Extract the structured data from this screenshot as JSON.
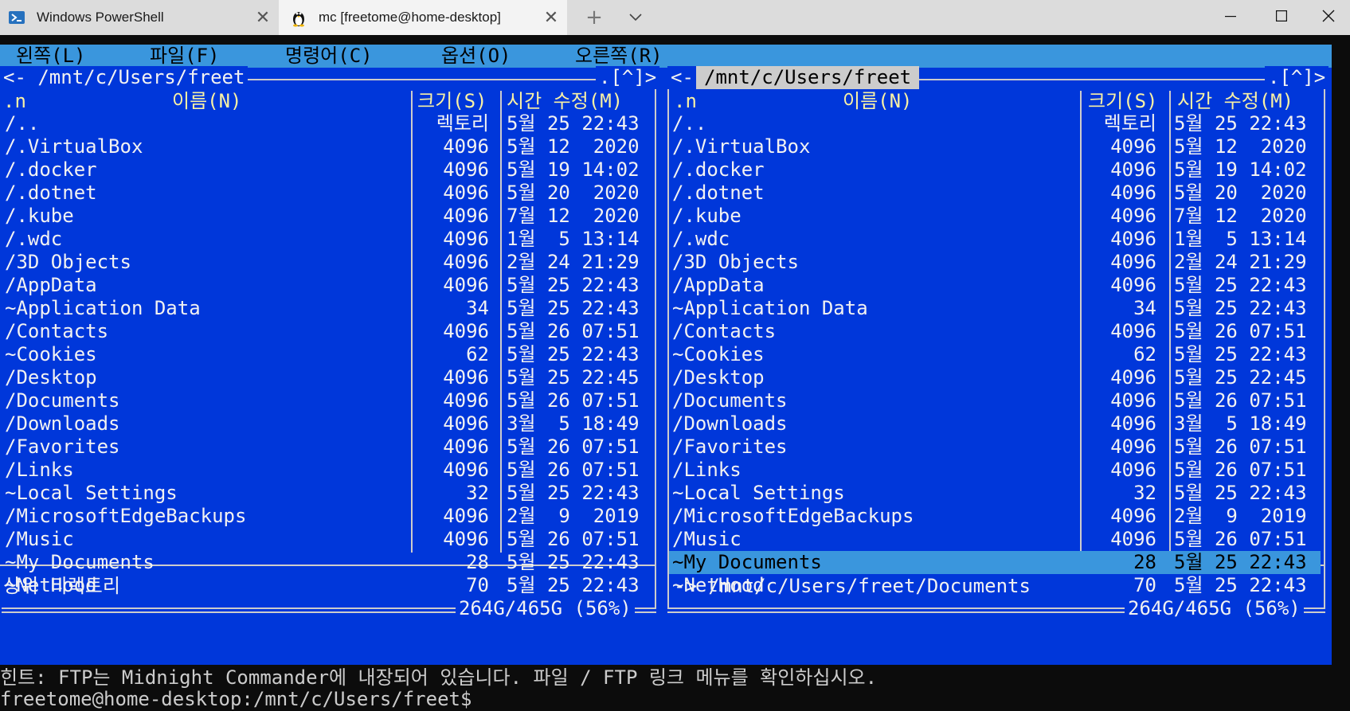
{
  "tabs": [
    {
      "title": "Windows PowerShell",
      "icon": "powershell-icon"
    },
    {
      "title": "mc [freetome@home-desktop]",
      "icon": "linux-penguin-icon"
    }
  ],
  "menu": [
    "왼쪽(L)",
    "파일(F)",
    "명령어(C)",
    "옵션(O)",
    "오른쪽(R)"
  ],
  "left_panel": {
    "path": "<- /mnt/c/Users/freet",
    "corner": ".[^]>",
    "sort_flag": ".n",
    "col_name": "이름(N)",
    "col_size": "크기(S)",
    "col_time": "시간 수정(M)",
    "status": "상위 디렉토리",
    "disk": "264G/465G (56%)"
  },
  "right_panel": {
    "path_prefix": "<-",
    "path": "/mnt/c/Users/freet",
    "corner": ".[^]>",
    "sort_flag": ".n",
    "col_name": "이름(N)",
    "col_size": "크기(S)",
    "col_time": "시간 수정(M)",
    "status": "-> /mnt/c/Users/freet/Documents",
    "disk": "264G/465G (56%)",
    "selected_index": 19
  },
  "files": [
    {
      "name": "/..",
      "size": "렉토리",
      "time": "5월 25 22:43"
    },
    {
      "name": "/.VirtualBox",
      "size": "4096",
      "time": "5월 12  2020"
    },
    {
      "name": "/.docker",
      "size": "4096",
      "time": "5월 19 14:02"
    },
    {
      "name": "/.dotnet",
      "size": "4096",
      "time": "5월 20  2020"
    },
    {
      "name": "/.kube",
      "size": "4096",
      "time": "7월 12  2020"
    },
    {
      "name": "/.wdc",
      "size": "4096",
      "time": "1월  5 13:14"
    },
    {
      "name": "/3D Objects",
      "size": "4096",
      "time": "2월 24 21:29"
    },
    {
      "name": "/AppData",
      "size": "4096",
      "time": "5월 25 22:43"
    },
    {
      "name": "~Application Data",
      "size": "34",
      "time": "5월 25 22:43"
    },
    {
      "name": "/Contacts",
      "size": "4096",
      "time": "5월 26 07:51"
    },
    {
      "name": "~Cookies",
      "size": "62",
      "time": "5월 25 22:43"
    },
    {
      "name": "/Desktop",
      "size": "4096",
      "time": "5월 25 22:45"
    },
    {
      "name": "/Documents",
      "size": "4096",
      "time": "5월 26 07:51"
    },
    {
      "name": "/Downloads",
      "size": "4096",
      "time": "3월  5 18:49"
    },
    {
      "name": "/Favorites",
      "size": "4096",
      "time": "5월 26 07:51"
    },
    {
      "name": "/Links",
      "size": "4096",
      "time": "5월 26 07:51"
    },
    {
      "name": "~Local Settings",
      "size": "32",
      "time": "5월 25 22:43"
    },
    {
      "name": "/MicrosoftEdgeBackups",
      "size": "4096",
      "time": "2월  9  2019"
    },
    {
      "name": "/Music",
      "size": "4096",
      "time": "5월 26 07:51"
    },
    {
      "name": "~My Documents",
      "size": "28",
      "time": "5월 25 22:43"
    },
    {
      "name": "~NetHood",
      "size": "70",
      "time": "5월 25 22:43"
    }
  ],
  "hint": "힌트: FTP는 Midnight Commander에 내장되어 있습니다. 파일 / FTP 링크 메뉴를 확인하십시오.",
  "prompt": "freetome@home-desktop:/mnt/c/Users/freet$ "
}
